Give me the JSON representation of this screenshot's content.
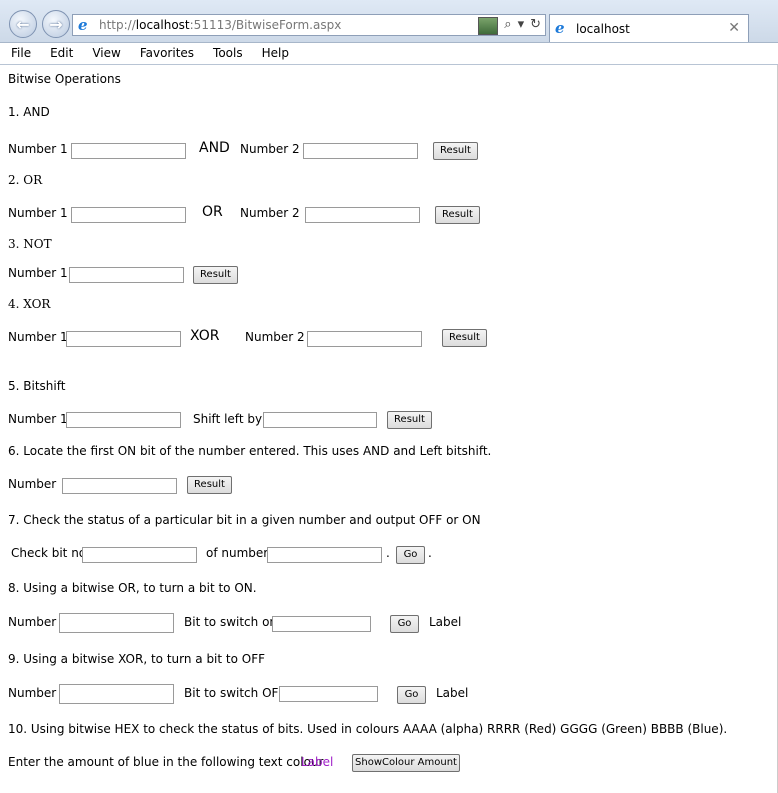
{
  "browser": {
    "url_prefix": "http://",
    "url_host": "localhost",
    "url_rest": ":51113/BitwiseForm.aspx",
    "tab_title": "localhost",
    "tab_close": "✕",
    "back_glyph": "←",
    "forward_glyph": "→",
    "search_glyph": "⌕",
    "dropdown_glyph": "▾",
    "refresh_glyph": "↻",
    "ie_glyph": "e"
  },
  "menu": [
    "File",
    "Edit",
    "View",
    "Favorites",
    "Tools",
    "Help"
  ],
  "page": {
    "title": "Bitwise Operations",
    "s1": {
      "heading": "1.  AND",
      "num1": "Number 1",
      "op": "AND",
      "num2": "Number 2",
      "btn": "Result"
    },
    "s2": {
      "heading": "2. OR",
      "num1": "Number 1",
      "op": "OR",
      "num2": "Number 2",
      "btn": "Result"
    },
    "s3": {
      "heading": "3. NOT",
      "num1": "Number 1",
      "btn": "Result"
    },
    "s4": {
      "heading": "4. XOR",
      "num1": "Number 1",
      "op": "XOR",
      "num2": "Number 2",
      "btn": "Result"
    },
    "s5": {
      "heading": "5. Bitshift",
      "num1": "Number 1",
      "shift": "Shift left by",
      "btn": "Result"
    },
    "s6": {
      "heading": "6. Locate the first ON bit of the number entered. This uses AND and Left bitshift.",
      "num": "Number",
      "btn": "Result"
    },
    "s7": {
      "heading": "7. Check the status of a particular bit in a given number and output OFF or ON",
      "bitno": "Check bit no",
      "ofnum": "of number",
      "dot1": ".",
      "btn": "Go",
      "dot2": "."
    },
    "s8": {
      "heading": "8. Using a bitwise OR, to turn a bit to ON.",
      "num": "Number",
      "bit": "Bit to switch on",
      "btn": "Go",
      "label": "Label"
    },
    "s9": {
      "heading": "9. Using a bitwise XOR, to turn a bit to OFF",
      "num": "Number",
      "bit": "Bit to switch OFF",
      "btn": "Go",
      "label": "Label"
    },
    "s10": {
      "heading": "10. Using bitwise HEX to check the status of bits. Used in colours  AAAA (alpha) RRRR (Red) GGGG (Green) BBBB (Blue).",
      "prompt": "Enter the amount of blue in the following text colour",
      "label": "Label",
      "btn": "ShowColour Amount"
    }
  },
  "colors": {
    "label_color": "#a020c8"
  }
}
